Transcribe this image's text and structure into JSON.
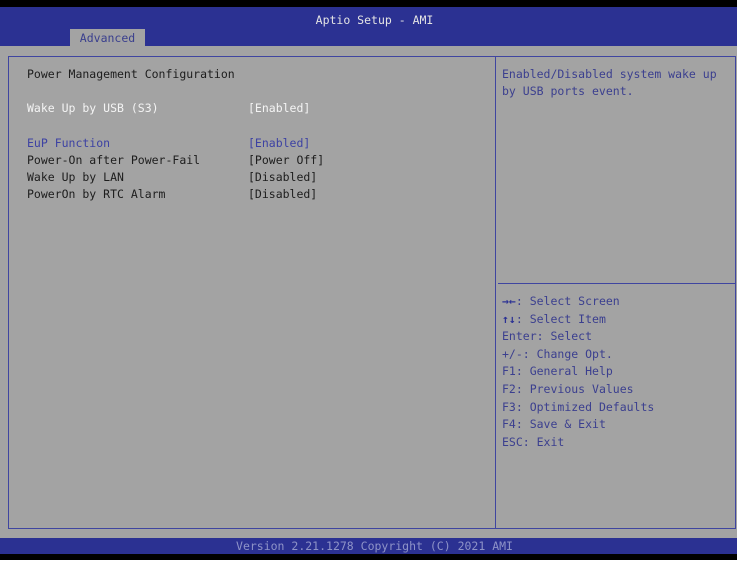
{
  "window": {
    "title": "Aptio Setup - AMI"
  },
  "tabs": [
    {
      "label": "Advanced",
      "active": true
    }
  ],
  "page": {
    "heading": "Power Management Configuration",
    "settings": [
      {
        "label": "Wake Up by USB (S3)",
        "value": "[Enabled]",
        "state": "selected"
      },
      {
        "label": "EuP Function",
        "value": "[Enabled]",
        "state": "link"
      },
      {
        "label": "Power-On after Power-Fail",
        "value": "[Power Off]",
        "state": "normal"
      },
      {
        "label": "Wake Up by LAN",
        "value": "[Disabled]",
        "state": "normal"
      },
      {
        "label": "PowerOn by RTC Alarm",
        "value": "[Disabled]",
        "state": "normal"
      }
    ]
  },
  "help": {
    "description": "Enabled/Disabled system wake up by USB ports event.",
    "keys": [
      {
        "key": "→←",
        "action": ": Select Screen"
      },
      {
        "key": "↑↓",
        "action": ": Select Item"
      },
      {
        "key": "Enter",
        "action": ": Select"
      },
      {
        "key": "+/-",
        "action": ": Change Opt."
      },
      {
        "key": "F1",
        "action": ": General Help"
      },
      {
        "key": "F2",
        "action": ": Previous Values"
      },
      {
        "key": "F3",
        "action": ": Optimized Defaults"
      },
      {
        "key": "F4",
        "action": ": Save & Exit"
      },
      {
        "key": "ESC",
        "action": ": Exit"
      }
    ]
  },
  "footer": {
    "version": "Version 2.21.1278 Copyright (C) 2021 AMI"
  },
  "colors": {
    "header_blue": "#2b3192",
    "body_gray": "#a3a3a3",
    "selected_text": "#f4f4f4",
    "link_text": "#3d42a3",
    "normal_text": "#1d1d1d"
  }
}
